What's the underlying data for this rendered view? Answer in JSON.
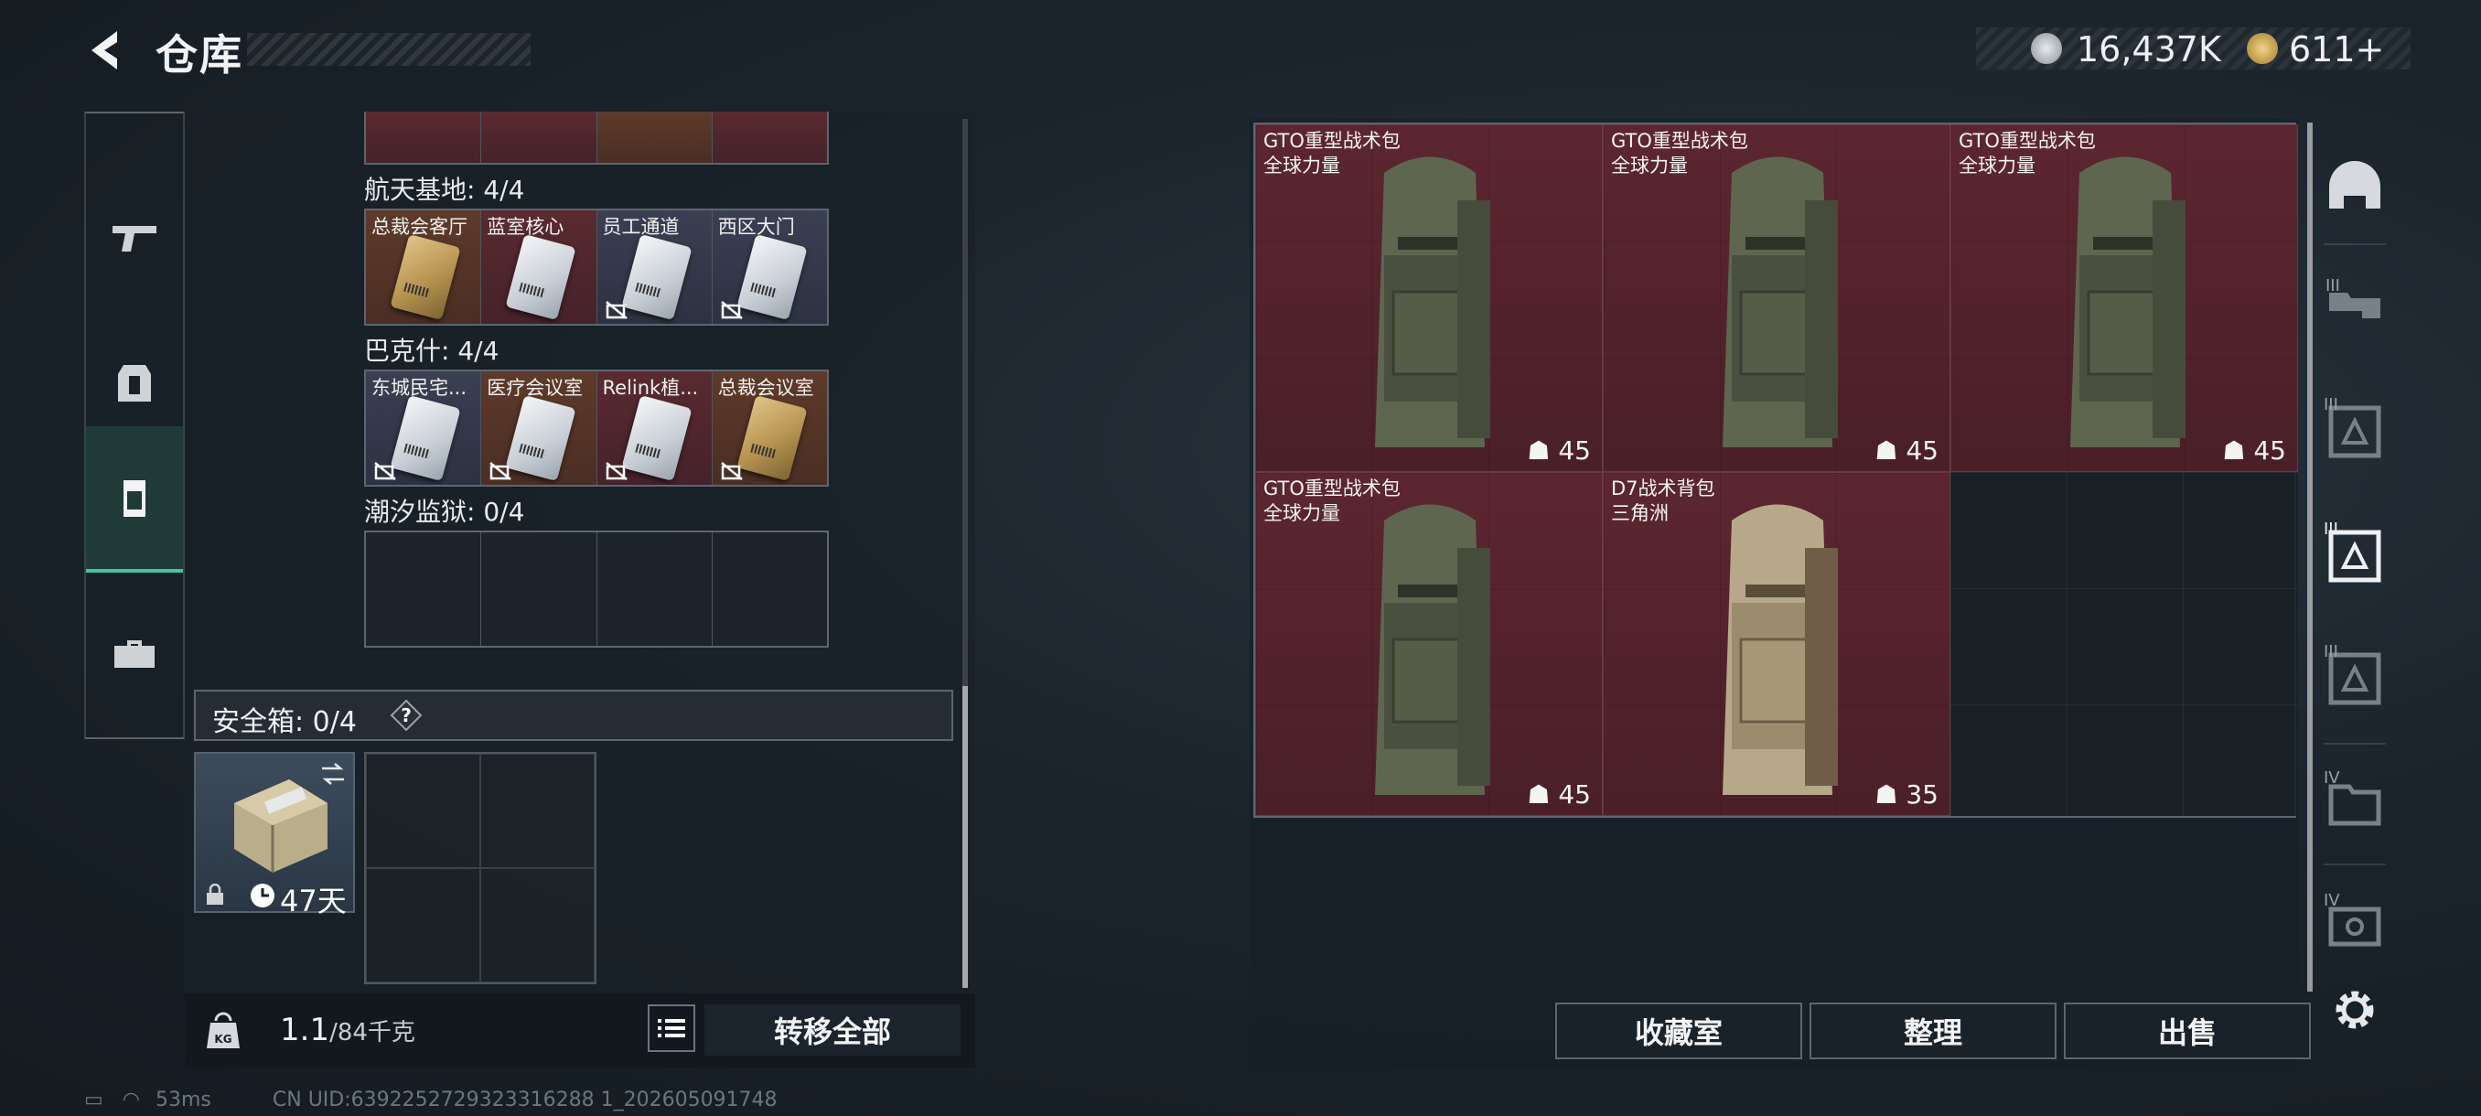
{
  "header": {
    "title": "仓库"
  },
  "currency": {
    "silver": "16,437K",
    "gold": "611+"
  },
  "left_panel": {
    "categories": [
      {
        "label": "航天基地: 4/4",
        "cells": [
          {
            "label": "总裁会客厅",
            "style": "gold",
            "card": "gold",
            "locked": false
          },
          {
            "label": "蓝室核心",
            "style": "red",
            "card": "silver",
            "locked": false
          },
          {
            "label": "员工通道",
            "style": "blue",
            "card": "silver",
            "locked": true
          },
          {
            "label": "西区大门",
            "style": "blue",
            "card": "silver",
            "locked": true
          }
        ]
      },
      {
        "label": "巴克什: 4/4",
        "cells": [
          {
            "label": "东城民宅...",
            "style": "blue",
            "card": "silver",
            "locked": true
          },
          {
            "label": "医疗会议室",
            "style": "gold",
            "card": "silver",
            "locked": true
          },
          {
            "label": "Relink植...",
            "style": "red",
            "card": "silver",
            "locked": true
          },
          {
            "label": "总裁会议室",
            "style": "gold",
            "card": "gold",
            "locked": true
          }
        ]
      },
      {
        "label": "潮汐监狱: 0/4",
        "cells": []
      }
    ],
    "safe_box": {
      "label": "安全箱: 0/4",
      "help": "?",
      "days": "47天"
    },
    "weight": {
      "current": "1.1",
      "capacity": "/84千克"
    },
    "transfer_all": "转移全部"
  },
  "right_panel": {
    "items": [
      {
        "name": "GTO重型战术包",
        "sub": "全球力量",
        "durability": "45",
        "color": "olive"
      },
      {
        "name": "GTO重型战术包",
        "sub": "全球力量",
        "durability": "45",
        "color": "olive"
      },
      {
        "name": "GTO重型战术包",
        "sub": "全球力量",
        "durability": "45",
        "color": "olive"
      },
      {
        "name": "GTO重型战术包",
        "sub": "全球力量",
        "durability": "45",
        "color": "olive"
      },
      {
        "name": "D7战术背包",
        "sub": "三角洲",
        "durability": "35",
        "color": "tan"
      }
    ],
    "buttons": {
      "collection": "收藏室",
      "organize": "整理",
      "sell": "出售"
    }
  },
  "right_rail": {
    "tiers": [
      "III",
      "III",
      "III",
      "III",
      "IV",
      "IV"
    ]
  },
  "status": {
    "ping": "53ms",
    "uid": "CN UID:6392252729323316288 1_202605091748"
  }
}
